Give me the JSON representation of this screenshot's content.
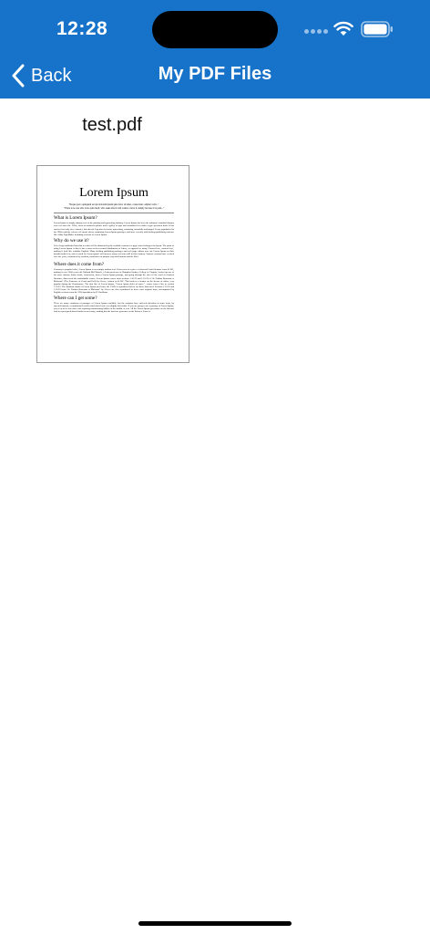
{
  "status_bar": {
    "time": "12:28"
  },
  "nav": {
    "back_label": "Back",
    "title": "My PDF Files"
  },
  "files": [
    {
      "name": "test.pdf",
      "preview": {
        "title": "Lorem Ipsum",
        "quote": "\"Neque porro quisquam est qui dolorem ipsum quia dolor sit amet, consectetur, adipisci velit...\"",
        "quote_sub": "\"There is no one who loves pain itself, who seeks after it and wants to have it, simply because it is pain...\"",
        "sections": [
          {
            "heading": "What is Lorem Ipsum?",
            "text": "Lorem Ipsum is simply dummy text of the printing and typesetting industry. Lorem Ipsum has been the industry's standard dummy text ever since the 1500s, when an unknown printer took a galley of type and scrambled it to make a type specimen book. It has survived not only five centuries, but also the leap into electronic typesetting, remaining essentially unchanged. It was popularised in the 1960s with the release of Letraset sheets containing Lorem Ipsum passages, and more recently with desktop publishing software like Aldus PageMaker including versions of Lorem Ipsum."
          },
          {
            "heading": "Why do we use it?",
            "text": "It is a long established fact that a reader will be distracted by the readable content of a page when looking at its layout. The point of using Lorem Ipsum is that it has a more-or-less normal distribution of letters, as opposed to using 'Content here, content here', making it look like readable English. Many desktop publishing packages and web page editors now use Lorem Ipsum as their default model text, and a search for 'lorem ipsum' will uncover many web sites still in their infancy. Various versions have evolved over the years, sometimes by accident, sometimes on purpose (injected humour and the like)."
          },
          {
            "heading": "Where does it come from?",
            "text": "Contrary to popular belief, Lorem Ipsum is not simply random text. It has roots in a piece of classical Latin literature from 45 BC, making it over 2000 years old. Richard McClintock, a Latin professor at Hampden-Sydney College in Virginia, looked up one of the more obscure Latin words, consectetur, from a Lorem Ipsum passage, and going through the cites of the word in classical literature, discovered the undoubtable source. Lorem Ipsum comes from sections 1.10.32 and 1.10.33 of \"de Finibus Bonorum et Malorum\" (The Extremes of Good and Evil) by Cicero, written in 45 BC. This book is a treatise on the theory of ethics, very popular during the Renaissance. The first line of Lorem Ipsum, \"Lorem ipsum dolor sit amet..\", comes from a line in section 1.10.32. The standard chunk of Lorem Ipsum used since the 1500s is reproduced below for those interested. Sections 1.10.32 and 1.10.33 from \"de Finibus Bonorum et Malorum\" by Cicero are also reproduced in their exact original form, accompanied by English versions from the 1914 translation by H. Rackham."
          },
          {
            "heading": "Where can I get some?",
            "text": "There are many variations of passages of Lorem Ipsum available, but the majority have suffered alteration in some form, by injected humour, or randomised words which don't look even slightly believable. If you are going to use a passage of Lorem Ipsum, you need to be sure there isn't anything embarrassing hidden in the middle of text. All the Lorem Ipsum generators on the Internet tend to repeat predefined chunks as necessary, making this the first true generator on the Internet. It uses a"
          }
        ]
      }
    }
  ],
  "colors": {
    "header_bg": "#1773c9",
    "header_text": "#ffffff",
    "thumbnail_border": "#9c9c9c"
  }
}
